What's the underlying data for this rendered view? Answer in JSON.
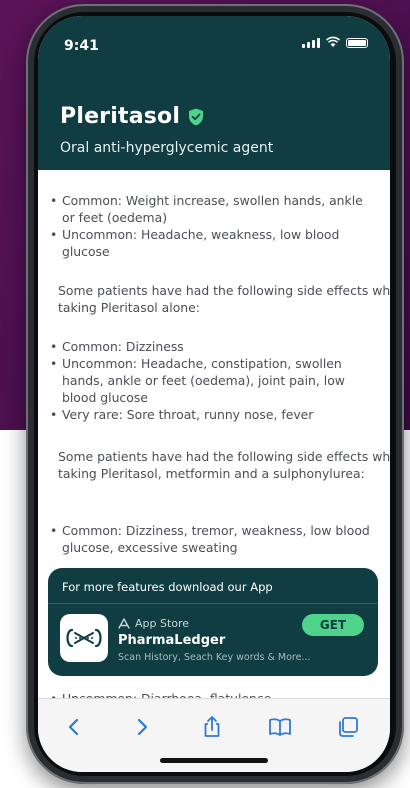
{
  "status": {
    "time": "9:41"
  },
  "header": {
    "title": "Pleritasol",
    "subtitle": "Oral anti-hyperglycemic agent"
  },
  "content": {
    "list1": [
      "Common: Weight increase, swollen hands, ankle or feet (oedema)",
      "Uncommon: Headache, weakness, low blood glucose"
    ],
    "para1": "Some patients have had the following side effects while taking Pleritasol alone:",
    "list2": [
      "Common: Dizziness",
      "Uncommon: Headache, constipation, swollen hands, ankle or feet (oedema), joint pain, low blood glucose",
      "Very rare: Sore throat, runny nose, fever"
    ],
    "para2": "Some patients have had the following side effects while taking Pleritasol, metformin and a sulphonylurea:",
    "list3": [
      "Common: Dizziness, tremor, weakness, low blood glucose, excessive sweating"
    ],
    "list4": [
      "Uncommon: Diarrhoea, flatulence"
    ]
  },
  "banner": {
    "heading": "For more features download our App",
    "store": "App Store",
    "app_name": "PharmaLedger",
    "description": "Scan History, Seach Key words & More...",
    "get_label": "GET"
  },
  "colors": {
    "header_bg": "#0f3d42",
    "accent_green": "#4fd28a",
    "background_purple": "#4a0f4f"
  },
  "toolbar": {
    "icons": [
      "back-icon",
      "forward-icon",
      "share-icon",
      "bookmarks-icon",
      "tabs-icon"
    ]
  }
}
